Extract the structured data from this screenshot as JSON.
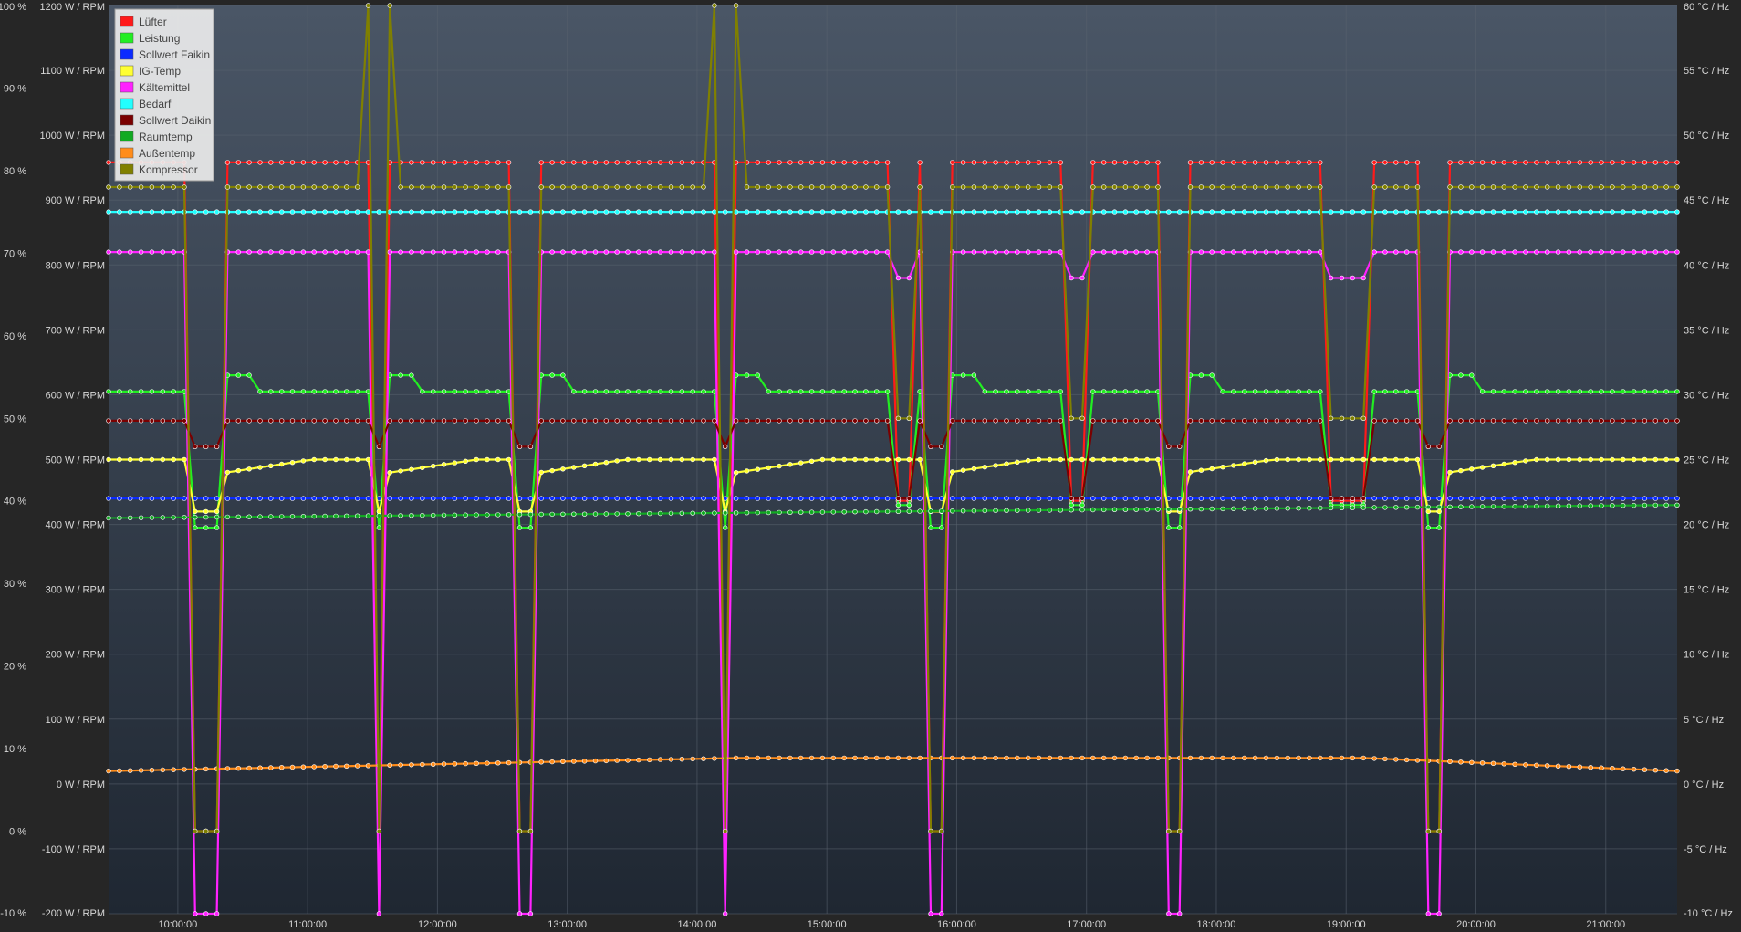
{
  "chart_data": {
    "type": "line",
    "grid": true,
    "legend_position": "top-left",
    "x_range": [
      "09:28:00",
      "21:33:00"
    ],
    "x_ticks": [
      "10:00:00",
      "11:00:00",
      "12:00:00",
      "13:00:00",
      "14:00:00",
      "15:00:00",
      "16:00:00",
      "17:00:00",
      "18:00:00",
      "19:00:00",
      "20:00:00",
      "21:00:00"
    ],
    "left_percent_axis": {
      "ticks": [
        "100 %",
        "90 %",
        "80 %",
        "70 %",
        "60 %",
        "50 %",
        "40 %",
        "30 %",
        "20 %",
        "10 %",
        "0 %",
        "-10 %"
      ],
      "range": [
        -10,
        100
      ]
    },
    "left_power_axis": {
      "ticks": [
        "1200 W / RPM",
        "1100 W / RPM",
        "1000 W / RPM",
        "900 W / RPM",
        "800 W / RPM",
        "700 W / RPM",
        "600 W / RPM",
        "500 W / RPM",
        "400 W / RPM",
        "300 W / RPM",
        "200 W / RPM",
        "100 W / RPM",
        "0 W / RPM",
        "-100 W / RPM",
        "-200 W / RPM"
      ],
      "range": [
        -200,
        1200
      ]
    },
    "right_axis": {
      "ticks": [
        "60 °C / Hz",
        "55 °C / Hz",
        "50 °C / Hz",
        "45 °C / Hz",
        "40 °C / Hz",
        "35 °C / Hz",
        "30 °C / Hz",
        "25 °C / Hz",
        "20 °C / Hz",
        "15 °C / Hz",
        "10 °C / Hz",
        "5 °C / Hz",
        "0 °C / Hz",
        "-5 °C / Hz",
        "-10 °C / Hz"
      ],
      "range": [
        -10,
        60
      ]
    },
    "off_periods": [
      {
        "start": "10:07",
        "end": "10:22"
      },
      {
        "start": "11:28",
        "end": "11:38"
      },
      {
        "start": "12:37",
        "end": "12:47"
      },
      {
        "start": "14:08",
        "end": "14:18"
      },
      {
        "start": "15:45",
        "end": "15:56"
      },
      {
        "start": "17:35",
        "end": "17:46"
      },
      {
        "start": "19:37",
        "end": "19:47"
      }
    ],
    "series": [
      {
        "name": "Lüfter",
        "color": "#ff1a1a",
        "axis": "percent",
        "on_value": 81,
        "off_value": 0,
        "dip_value": 40,
        "dips": [
          "15:35",
          "16:55",
          "18:55",
          "19:05"
        ]
      },
      {
        "name": "Leistung",
        "color": "#22ee22",
        "axis": "power",
        "on_value": 605,
        "peak_value": 630,
        "off_value": 395,
        "dip_value": 430,
        "dips": [
          "15:35",
          "16:55",
          "18:55",
          "19:05"
        ]
      },
      {
        "name": "Sollwert Faikin",
        "color": "#0a2aff",
        "axis": "temp",
        "on_value": 22,
        "off_value": 22
      },
      {
        "name": "IG-Temp",
        "color": "#ffff33",
        "axis": "temp",
        "on_value": 25,
        "start_value": 24,
        "off_value": 21
      },
      {
        "name": "Kältemittel",
        "color": "#ff22ff",
        "axis": "temp",
        "on_value": 41,
        "off_value": -10,
        "dip_value": 39,
        "dips": [
          "15:35",
          "16:55",
          "18:55",
          "19:05"
        ]
      },
      {
        "name": "Bedarf",
        "color": "#22ffff",
        "axis": "percent",
        "on_value": 75,
        "off_value": 75
      },
      {
        "name": "Sollwert Daikin",
        "color": "#7a0000",
        "axis": "temp",
        "on_value": 28,
        "off_value": 26,
        "dip_value": 22,
        "dips": [
          "15:35",
          "16:55",
          "18:55",
          "19:05"
        ]
      },
      {
        "name": "Raumtemp",
        "color": "#11aa22",
        "axis": "temp",
        "on_value": 21.5,
        "start_value": 20.5,
        "end_value": 21.5
      },
      {
        "name": "Außentemp",
        "color": "#ff8c1a",
        "axis": "temp",
        "on_value": 1,
        "start_value": 1,
        "mid_value": 2,
        "end_value": 1
      },
      {
        "name": "Kompressor",
        "color": "#808000",
        "axis": "percent",
        "on_value": 78,
        "off_value": 0,
        "spike_value": 100,
        "dip_value": 50,
        "dips": [
          "15:35",
          "16:55",
          "18:55",
          "19:05"
        ]
      }
    ]
  }
}
